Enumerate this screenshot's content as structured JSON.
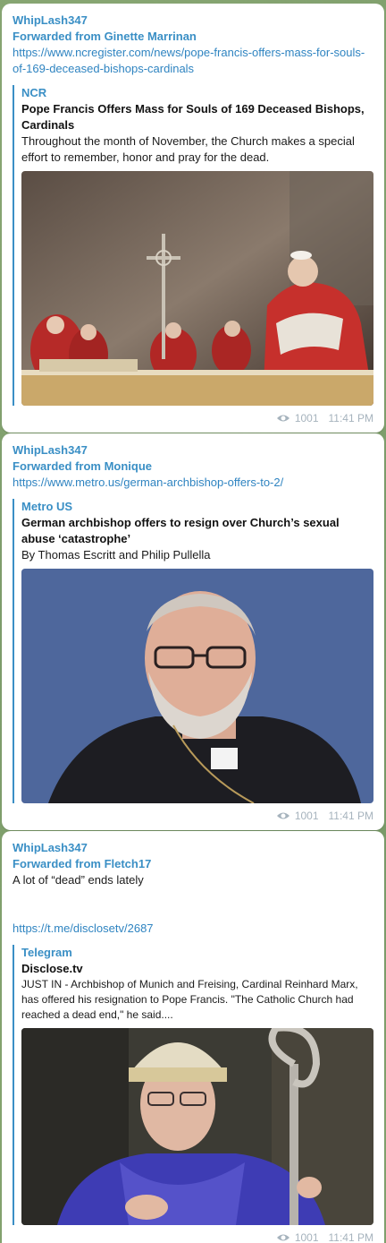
{
  "messages": [
    {
      "sender": "WhipLash347",
      "forwarded": "Forwarded from Ginette Marrinan",
      "link": "https://www.ncregister.com/news/pope-francis-offers-mass-for-souls-of-169-deceased-bishops-cardinals",
      "preview": {
        "site": "NCR",
        "title": "Pope Francis Offers Mass for Souls of 169 Deceased Bishops, Cardinals",
        "description": "Throughout the month of November, the Church makes a special effort to remember, honor and pray for the dead."
      },
      "views": "1001",
      "time": "11:41 PM"
    },
    {
      "sender": "WhipLash347",
      "forwarded": "Forwarded from Monique",
      "link": "https://www.metro.us/german-archbishop-offers-to-2/",
      "preview": {
        "site": "Metro US",
        "title": "German archbishop offers to resign over Church’s sexual abuse ‘catastrophe’",
        "description": "By Thomas Escritt and Philip Pullella"
      },
      "views": "1001",
      "time": "11:41 PM"
    },
    {
      "sender": "WhipLash347",
      "forwarded": "Forwarded from Fletch17",
      "text": "A lot of “dead” ends lately",
      "link": "https://t.me/disclosetv/2687",
      "preview": {
        "site": "Telegram",
        "title": "Disclose.tv",
        "description": "JUST IN - Archbishop of Munich and Freising, Cardinal Reinhard Marx, has offered his resignation to Pope Francis. \"The Catholic Church had reached a dead end,\" he said...."
      },
      "views": "1001",
      "time": "11:41 PM"
    }
  ],
  "icons": {
    "views": "eye-icon"
  },
  "colors": {
    "accent": "#3a8fc5",
    "meta": "#a6b3bd",
    "background": "#7e9e6c"
  }
}
